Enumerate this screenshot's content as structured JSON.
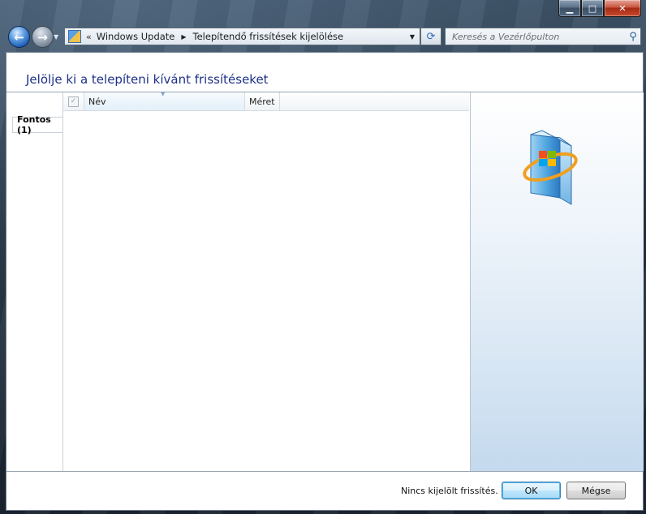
{
  "window": {
    "minimize_glyph": "▁",
    "maximize_glyph": "□",
    "close_glyph": "✕"
  },
  "nav": {
    "back_glyph": "←",
    "forward_glyph": "→",
    "breadcrumb_chevron": "«",
    "breadcrumb": [
      "Windows Update",
      "Telepítendő frissítések kijelölése"
    ],
    "search_placeholder": "Keresés a Vezérlőpulton"
  },
  "main": {
    "title": "Jelölje ki a telepíteni kívánt frissítéseket",
    "tabs": [
      {
        "label": "Fontos (1)",
        "selected": true
      }
    ],
    "columns": {
      "name": "Név",
      "size": "Méret"
    },
    "rows": []
  },
  "footer": {
    "status": "Nincs kijelölt frissítés.",
    "ok_label": "OK",
    "cancel_label": "Mégse"
  },
  "colors": {
    "title": "#1e3287",
    "accent": "#3c7fb1"
  },
  "icons": [
    "back-arrow-icon",
    "forward-arrow-icon",
    "control-panel-icon",
    "refresh-icon",
    "search-icon",
    "windows-update-icon"
  ]
}
